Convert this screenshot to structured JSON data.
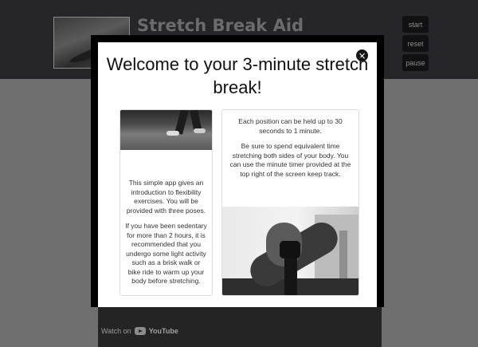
{
  "app": {
    "title": "Stretch Break Aid",
    "buttons": {
      "start": "start",
      "reset": "reset",
      "pause": "pause"
    },
    "video": {
      "watch_on": "Watch on",
      "youtube": "YouTube"
    }
  },
  "modal": {
    "title": "Welcome to your 3-minute stretch break!",
    "close_glyph": "×",
    "left_card": {
      "p1": "This simple app gives an introduction to flexibility exercises. You will be provided with three poses.",
      "p2": "If you have been sedentary for more than 2 hours, it is recommended that you undergo some light activity such as a brisk walk or bike ride to warm up your body before stretching."
    },
    "right_card": {
      "p1": "Each position can be held up to 30 seconds to 1 minute.",
      "p2": "Be sure to spend equivalent time stretching both sides of your body. You can use the minute timer provided at the top right of the screen keep track."
    }
  },
  "colors": {
    "header_bg": "#26252a",
    "overlay_bg": "#6f6f6f",
    "modal_bg": "#ffffff",
    "modal_border": "#000000"
  },
  "icons": {
    "close": "close-icon",
    "youtube": "youtube-icon"
  }
}
